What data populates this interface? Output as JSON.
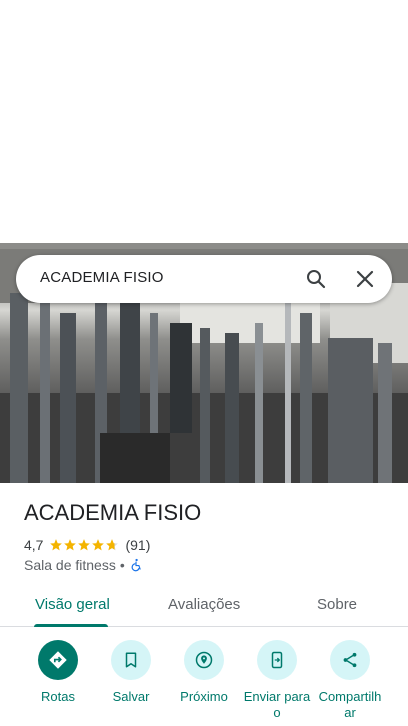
{
  "search": {
    "query": "ACADEMIA FISIO"
  },
  "place": {
    "name": "ACADEMIA FISIO",
    "rating": "4,7",
    "rating_value": 4.7,
    "reviews_count": "(91)",
    "category": "Sala de fitness",
    "separator": "•"
  },
  "tabs": [
    {
      "label": "Visão geral",
      "active": true
    },
    {
      "label": "Avaliações",
      "active": false
    },
    {
      "label": "Sobre",
      "active": false
    }
  ],
  "actions": [
    {
      "label": "Rotas",
      "icon": "directions-icon"
    },
    {
      "label": "Salvar",
      "icon": "bookmark-icon"
    },
    {
      "label": "Próximo",
      "icon": "nearby-icon"
    },
    {
      "label": "Enviar para o",
      "icon": "send-to-phone-icon"
    },
    {
      "label": "Compartilhar",
      "icon": "share-icon"
    }
  ],
  "colors": {
    "accent": "#00796b",
    "star": "#f4b400",
    "action_bg": "#d5f5f7"
  }
}
